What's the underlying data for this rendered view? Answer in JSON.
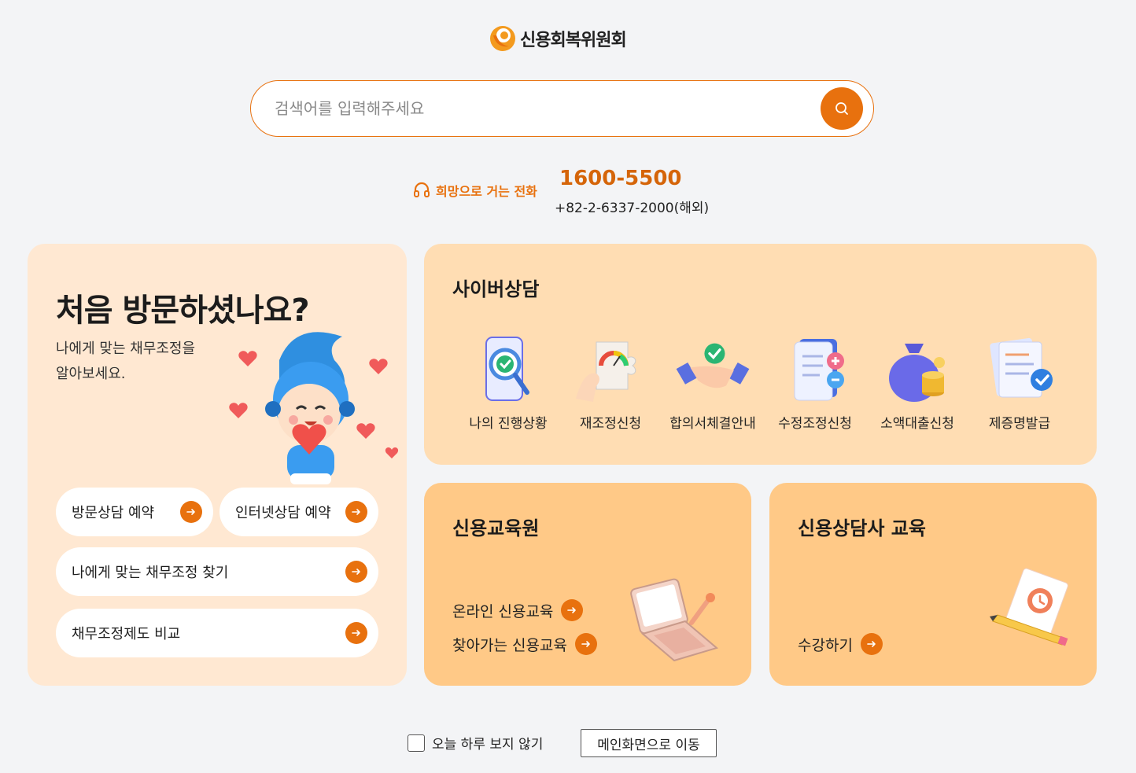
{
  "brand": {
    "name": "신용회복위원회"
  },
  "search": {
    "placeholder": "검색어를 입력해주세요"
  },
  "phone": {
    "label": "희망으로 거는 전화",
    "number": "1600-5500",
    "overseas": "+82-2-6337-2000(해외)"
  },
  "visit": {
    "title": "처음 방문하셨나요?",
    "desc_line1": "나에게 맞는 채무조정을",
    "desc_line2": "알아보세요.",
    "buttons": [
      {
        "label": "방문상담 예약"
      },
      {
        "label": "인터넷상담 예약"
      },
      {
        "label": "나에게 맞는 채무조정 찾기"
      },
      {
        "label": "채무조정제도 비교"
      }
    ]
  },
  "cyber": {
    "title": "사이버상담",
    "items": [
      {
        "label": "나의 진행상황",
        "icon": "magnifier-check-icon"
      },
      {
        "label": "재조정신청",
        "icon": "puzzle-gauge-icon"
      },
      {
        "label": "합의서체결안내",
        "icon": "handshake-icon"
      },
      {
        "label": "수정조정신청",
        "icon": "document-plus-minus-icon"
      },
      {
        "label": "소액대출신청",
        "icon": "money-bag-icon"
      },
      {
        "label": "제증명발급",
        "icon": "certificate-check-icon"
      }
    ]
  },
  "education": {
    "title": "신용교육원",
    "links": [
      {
        "label": "온라인 신용교육"
      },
      {
        "label": "찾아가는 신용교육"
      }
    ]
  },
  "counselor": {
    "title": "신용상담사 교육",
    "links": [
      {
        "label": "수강하기"
      }
    ]
  },
  "footer": {
    "no_show_label": "오늘 하루 보지 않기",
    "main_button": "메인화면으로 이동"
  },
  "colors": {
    "accent": "#e8710e",
    "visit_bg": "#ffe8d2",
    "cyber_bg": "#ffddb3",
    "edu_bg": "#ffc987",
    "page_bg": "#f3f4f6"
  }
}
